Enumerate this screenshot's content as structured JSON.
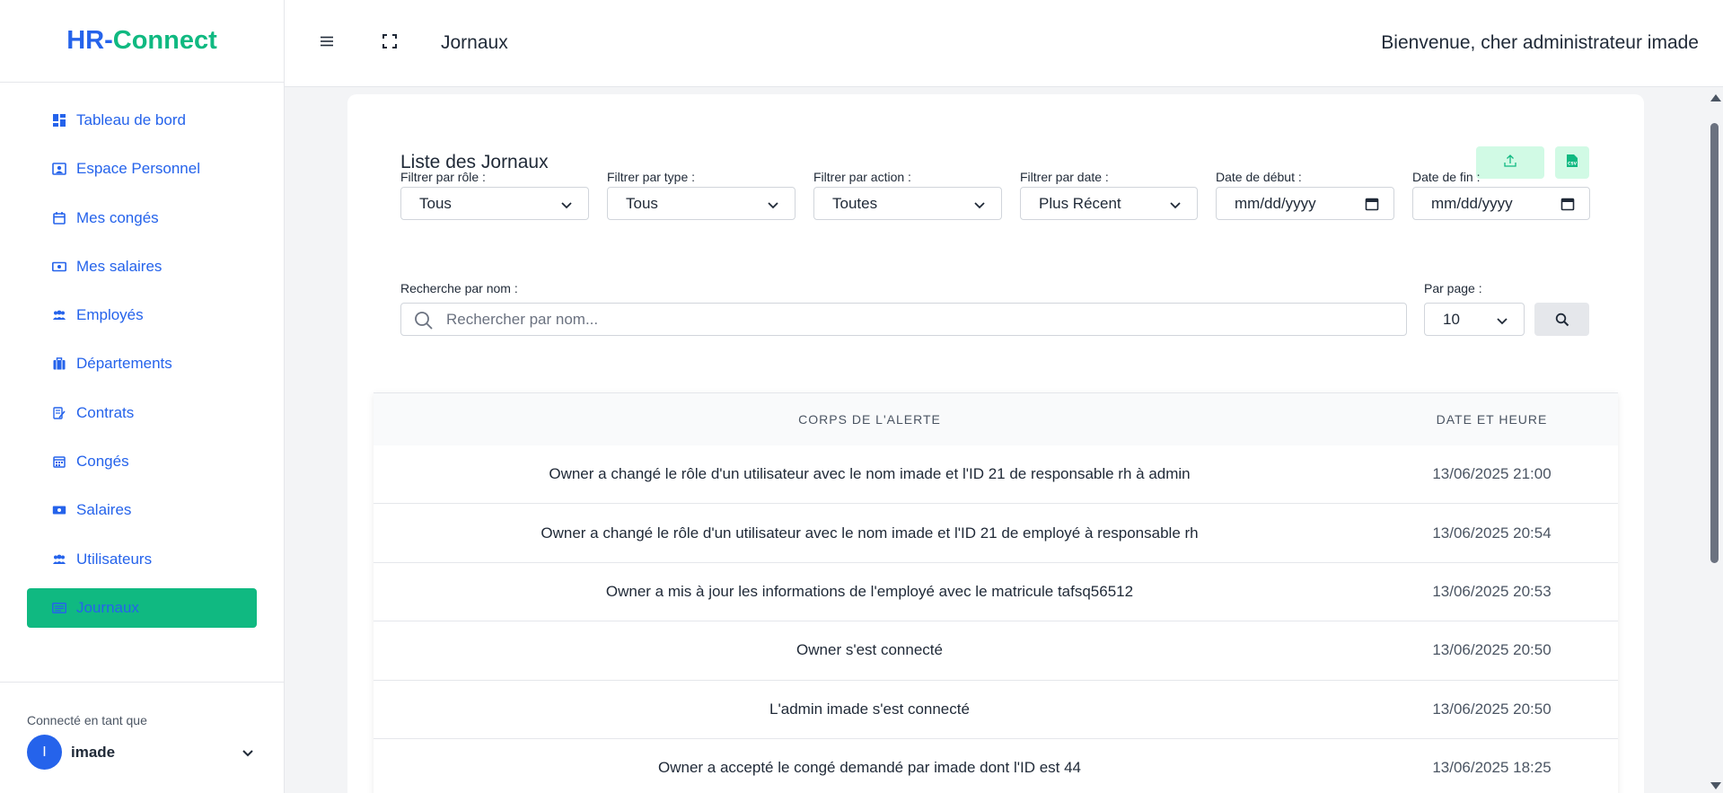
{
  "app": {
    "logo_part1": "HR-",
    "logo_part2": "Connect"
  },
  "sidebar": {
    "items": [
      {
        "label": "Tableau de bord",
        "icon": "dashboard-icon"
      },
      {
        "label": "Espace Personnel",
        "icon": "personal-space-icon"
      },
      {
        "label": "Mes congés",
        "icon": "calendar-icon"
      },
      {
        "label": "Mes salaires",
        "icon": "money-icon"
      },
      {
        "label": "Employés",
        "icon": "people-icon"
      },
      {
        "label": "Départements",
        "icon": "briefcase-icon"
      },
      {
        "label": "Contrats",
        "icon": "contract-icon"
      },
      {
        "label": "Congés",
        "icon": "calendar-grid-icon"
      },
      {
        "label": "Salaires",
        "icon": "money-icon"
      },
      {
        "label": "Utilisateurs",
        "icon": "users-icon"
      },
      {
        "label": "Journaux",
        "icon": "log-icon",
        "active": true
      }
    ],
    "footer": {
      "label": "Connecté en tant que",
      "avatar_initial": "I",
      "username": "imade"
    }
  },
  "header": {
    "title": "Jornaux",
    "welcome": "Bienvenue, cher administrateur imade"
  },
  "card": {
    "title": "Liste des Jornaux",
    "filters": {
      "role": {
        "label": "Filtrer par rôle :",
        "value": "Tous"
      },
      "type": {
        "label": "Filtrer par type :",
        "value": "Tous"
      },
      "action": {
        "label": "Filtrer par action :",
        "value": "Toutes"
      },
      "date": {
        "label": "Filtrer par date :",
        "value": "Plus Récent"
      },
      "start": {
        "label": "Date de début :",
        "value": "mm/dd/yyyy"
      },
      "end": {
        "label": "Date de fin :",
        "value": "mm/dd/yyyy"
      }
    },
    "search": {
      "label": "Recherche par nom :",
      "placeholder": "Rechercher par nom..."
    },
    "per_page": {
      "label": "Par page :",
      "value": "10"
    }
  },
  "table": {
    "headers": [
      "CORPS DE L'ALERTE",
      "DATE ET HEURE"
    ],
    "rows": [
      {
        "body": "Owner a changé le rôle d'un utilisateur avec le nom imade et l'ID 21 de responsable rh à admin",
        "date": "13/06/2025 21:00"
      },
      {
        "body": "Owner a changé le rôle d'un utilisateur avec le nom imade et l'ID 21 de employé à responsable rh",
        "date": "13/06/2025 20:54"
      },
      {
        "body": "Owner a mis à jour les informations de l'employé avec le matricule tafsq56512",
        "date": "13/06/2025 20:53"
      },
      {
        "body": "Owner s'est connecté",
        "date": "13/06/2025 20:50"
      },
      {
        "body": "L'admin imade s'est connecté",
        "date": "13/06/2025 20:50"
      },
      {
        "body": "Owner a accepté le congé demandé par imade dont l'ID est 44",
        "date": "13/06/2025 18:25"
      }
    ]
  },
  "colors": {
    "accent_blue": "#2563eb",
    "accent_green": "#10b981",
    "light_green": "#d1fae5"
  }
}
